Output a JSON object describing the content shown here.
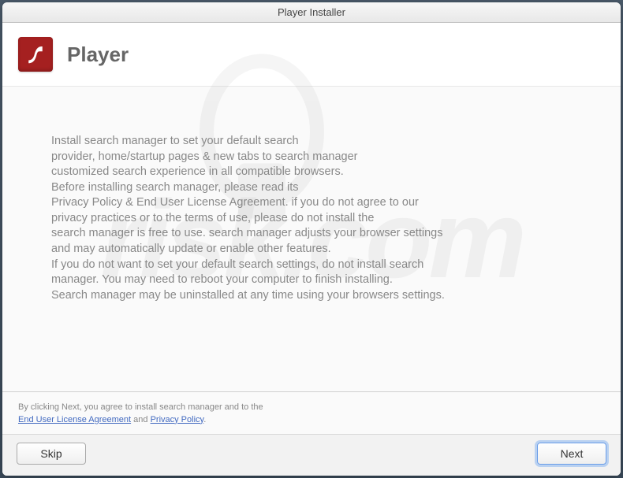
{
  "window": {
    "title": "Player Installer"
  },
  "header": {
    "app_name": "Player",
    "logo_name": "flash-icon"
  },
  "body": {
    "text": "Install search manager to set your default search\nprovider, home/startup pages & new tabs to search manager\ncustomized search experience in all compatible browsers.\nBefore installing search manager, please read its\nPrivacy Policy & End User License Agreement. if you do not agree to our\nprivacy practices or to the terms of use, please do not install the\nsearch manager is free to use. search manager adjusts your browser settings\nand may automatically update or enable other features.\nIf you do not want to set your default search settings, do not install search\nmanager. You may need to reboot your computer to finish installing.\nSearch manager may be uninstalled at any time using your browsers settings."
  },
  "legal": {
    "intro": "By clicking Next, you agree to install search manager and to the",
    "eula": "End User License Agreement",
    "and": " and ",
    "privacy": "Privacy Policy",
    "period": "."
  },
  "buttons": {
    "skip": "Skip",
    "next": "Next"
  },
  "watermark": {
    "text": "risk.com"
  }
}
